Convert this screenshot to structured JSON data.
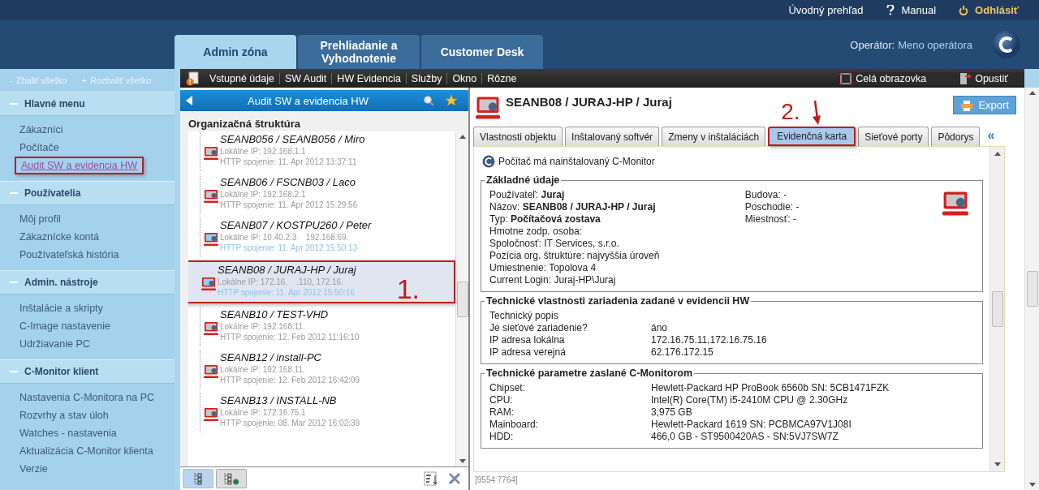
{
  "top_links": [
    {
      "kind": "home",
      "label": "Úvodný prehľad"
    },
    {
      "kind": "help",
      "label": "Manual"
    },
    {
      "kind": "logout",
      "label": "Odhlásiť"
    }
  ],
  "main_tabs": [
    {
      "label": "Admin zóna",
      "selected": true
    },
    {
      "label": "Prehliadanie a Vyhodnotenie",
      "selected": false
    },
    {
      "label": "Customer Desk",
      "selected": false
    }
  ],
  "operator": {
    "label": "Operátor:",
    "name": "Meno operátora"
  },
  "sidebar": {
    "collapse_all": {
      "sign": "-",
      "label": "Zbaliť všetko"
    },
    "expand_all": {
      "sign": "+",
      "label": "Rozbaliť všetko"
    },
    "sections": [
      {
        "title": "Hlavné menu",
        "expanded": true,
        "items": [
          {
            "label": "Zákazníci",
            "selected": false
          },
          {
            "label": "Počítače",
            "selected": false
          },
          {
            "label": "Audit SW a evidencia HW",
            "selected": true
          }
        ]
      },
      {
        "title": "Používatelia",
        "expanded": true,
        "items": [
          {
            "label": "Môj profil",
            "selected": false
          },
          {
            "label": "Zákaznícke kontá",
            "selected": false
          },
          {
            "label": "Používateľská história",
            "selected": false
          }
        ]
      },
      {
        "title": "Admin. nástroje",
        "expanded": true,
        "items": [
          {
            "label": "Inštalácie a skripty",
            "selected": false
          },
          {
            "label": "C-Image nastavenie",
            "selected": false
          },
          {
            "label": "Udržiavanie PC",
            "selected": false
          }
        ]
      },
      {
        "title": "C-Monitor klient",
        "expanded": true,
        "items": [
          {
            "label": "Nastavenia C-Monitora na PC",
            "selected": false
          },
          {
            "label": "Rozvrhy a stav úloh",
            "selected": false
          },
          {
            "label": "Watches - nastavenia",
            "selected": false
          },
          {
            "label": "Aktualizácia C-Monitor klienta",
            "selected": false
          },
          {
            "label": "Verzie",
            "selected": false
          }
        ]
      }
    ]
  },
  "menu_bar": {
    "items": [
      "Vstupné údaje",
      "SW Audit",
      "HW Evidencia",
      "Služby",
      "Okno",
      "Rôzne"
    ],
    "right": [
      {
        "kind": "fullscreen",
        "label": "Celá obrazovka"
      },
      {
        "kind": "exit",
        "label": "Opustiť"
      }
    ]
  },
  "left_panel": {
    "title": "Audit SW a evidencia HW",
    "tree_heading": "Organizačná štruktúra",
    "nodes": [
      {
        "name": "SEANB056 / SEANB056 / Miro",
        "ip": "Lokálne IP: 192.168.1.1",
        "http": "HTTP spojenie: 11. Apr 2012 13:37:11",
        "online": false,
        "selected": false
      },
      {
        "name": "SEANB06 / FSCNB03 / Laco",
        "ip": "Lokálne IP: 192.168.2.1",
        "http": "HTTP spojenie: 11. Apr 2012 15:29:56",
        "online": false,
        "selected": false
      },
      {
        "name": "SEANB07 / KOSTPU260 / Peter",
        "ip": "Lokálne IP: 10.40.2.3    192.168.69.",
        "http": "HTTP spojenie: 11. Apr 2012 15:50:13",
        "online": true,
        "selected": false
      },
      {
        "name": "SEANB08 / JURAJ-HP / Juraj",
        "ip": "Lokálne IP: 172.16.    .110, 172.16.",
        "http": "HTTP spojenie: 11. Apr 2012 15:50:16",
        "online": true,
        "selected": true
      },
      {
        "name": "SEANB10 / TEST-VHD",
        "ip": "Lokálne IP: 192.168.11.",
        "http": "HTTP spojenie: 12. Feb 2012 11:16:10",
        "online": false,
        "selected": false
      },
      {
        "name": "SEANB12 / install-PC",
        "ip": "Lokálne IP: 192.168.11.",
        "http": "HTTP spojenie: 12. Feb 2012 16:42:09",
        "online": false,
        "selected": false
      },
      {
        "name": "SEANB13 / INSTALL-NB",
        "ip": "Lokálne IP: 172.16.75.1",
        "http": "HTTP spojenie: 08. Mar 2012 16:02:39",
        "online": false,
        "selected": false
      }
    ],
    "view_buttons": [
      {
        "kind": "tree",
        "selected": true
      },
      {
        "kind": "tree-globe",
        "selected": false
      }
    ]
  },
  "callouts": [
    {
      "label": "1."
    },
    {
      "label": "2."
    }
  ],
  "right_panel": {
    "title": "SEANB08 / JURAJ-HP / Juraj",
    "export": "Export",
    "tabs": [
      {
        "label": "Vlastnosti objektu",
        "selected": false
      },
      {
        "label": "Inštalovaný softvér",
        "selected": false
      },
      {
        "label": "Zmeny v inštaláciách",
        "selected": false
      },
      {
        "label": "Evidenčná karta",
        "selected": true
      },
      {
        "label": "Sieťové porty",
        "selected": false
      },
      {
        "label": "Pôdorys",
        "selected": false
      }
    ],
    "tabs_more": "«",
    "notice": "Počítač má nainštalovaný C-Monitor",
    "groups": [
      {
        "kind": "columns",
        "title": "Základné údaje",
        "left": [
          "Používateľ: **Juraj**",
          "Názov: **SEANB08 / JURAJ-HP / Juraj**",
          "Typ: **Počítačová zostava**",
          "Hmotne zodp. osoba:",
          "Spoločnosť: IT Services, s.r.o.",
          "Pozícia org. štruktúre: najvyššia úroveň",
          "Umiestnenie: Topolova 4",
          "Current Login: Juraj-HP\\Juraj"
        ],
        "right": [
          "Budova: -",
          "Poschodie: -",
          "Miestnosť: -"
        ]
      },
      {
        "kind": "table",
        "title": "Technické vlastnosti zariadenia zadané v evidencii HW",
        "rows": [
          [
            "Technický popis",
            ""
          ],
          [
            "Je sieťové zariadenie?",
            "áno"
          ],
          [
            "IP adresa lokálna",
            "172.16.75.11,172.16.75.16"
          ],
          [
            "IP adresa verejná",
            "62.176.172.15"
          ]
        ]
      },
      {
        "kind": "table",
        "title": "Technické parametre zaslané C-Monitorom",
        "rows": [
          [
            "Chipset:",
            "Hewlett-Packard HP ProBook 6560b SN: 5CB1471FZK"
          ],
          [
            "CPU:",
            "Intel(R) Core(TM) i5-2410M CPU @ 2.30GHz"
          ],
          [
            "RAM:",
            "3,975 GB"
          ],
          [
            "Mainboard:",
            "Hewlett-Packard 1619 SN: PCBMCA97V1J08I"
          ],
          [
            "HDD:",
            "466,0 GB - ST9500420AS - SN:5VJ7SW7Z"
          ]
        ]
      }
    ],
    "footer": "[9554 7764]"
  }
}
